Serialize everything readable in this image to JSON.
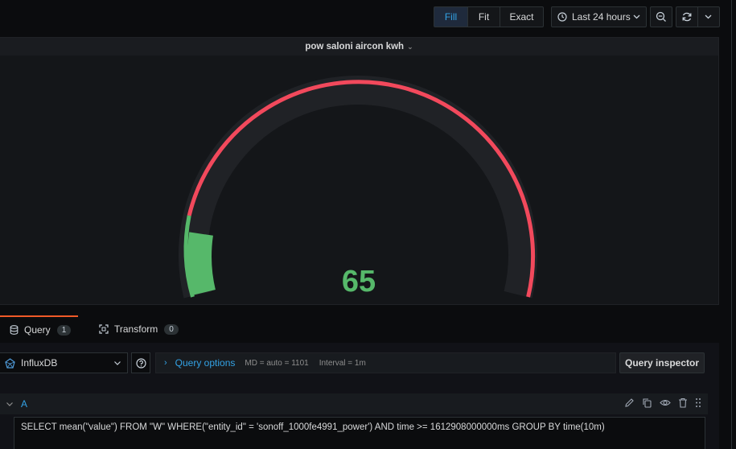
{
  "toolbar": {
    "view_modes": [
      {
        "label": "Fill",
        "active": true
      },
      {
        "label": "Fit",
        "active": false
      },
      {
        "label": "Exact",
        "active": false
      }
    ],
    "time_range": "Last 24 hours",
    "icons": {
      "clock": "clock-icon",
      "zoom_out": "zoom-out-icon",
      "refresh": "refresh-icon",
      "dropdown": "chevron-down-icon"
    }
  },
  "panel": {
    "title": "pow saloni aircon kwh"
  },
  "gauge": {
    "value": "65",
    "value_color": "#56b86a",
    "threshold_green": "#56b86a",
    "threshold_red": "#f2495c",
    "track_color": "#202226"
  },
  "tabs": [
    {
      "label": "Query",
      "count": "1",
      "active": true,
      "icon": "database-icon"
    },
    {
      "label": "Transform",
      "count": "0",
      "active": false,
      "icon": "transform-icon"
    }
  ],
  "query_editor": {
    "datasource": "InfluxDB",
    "query_options_label": "Query options",
    "md": "MD = auto = 1101",
    "interval": "Interval = 1m",
    "inspector_label": "Query inspector",
    "query_ref": "A",
    "query_text": "SELECT mean(\"value\") FROM \"W\" WHERE(\"entity_id\" = 'sonoff_1000fe4991_power') AND time >= 1612908000000ms GROUP BY time(10m)"
  }
}
